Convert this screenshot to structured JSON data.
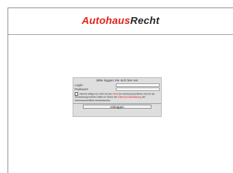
{
  "header": {
    "logo_part1": "Autohaus",
    "logo_part2": "Recht"
  },
  "login": {
    "heading": "Bitte loggen Sie sich hier ein",
    "login_label": "Login:",
    "password_label": "Passwort:",
    "consent_text_1": "Hiermit willige ich nicht mit den",
    "consent_link_1": "AGB",
    "consent_text_2": "der Autohausrechtlinie und mit der Verwendung meiner Daten im Sinne der",
    "consent_link_2": "Datenschutzerklärung",
    "consent_text_3": "der Autohausrechtlinie einverstanden.",
    "submit_label": "einloggen"
  },
  "colors": {
    "brand_red": "#e2231a",
    "brand_dark": "#2a2a2a"
  }
}
